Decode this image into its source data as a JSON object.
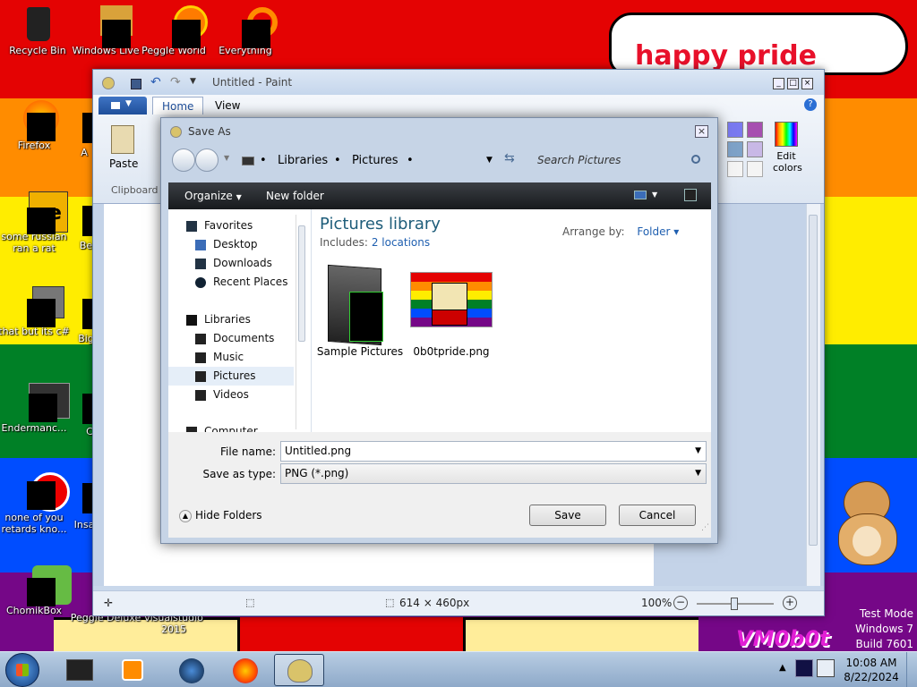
{
  "desktop": {
    "colors": {
      "red": "#e40303",
      "orange": "#ff8c00",
      "yellow": "#ffed00",
      "green": "#008026",
      "blue": "#004dff",
      "purple": "#750787"
    },
    "bubble_text": "happy pride month",
    "icons": [
      {
        "label": "Recycle Bin",
        "name": "recycle-bin-icon"
      },
      {
        "label": "Windows Live",
        "name": "windows-live-icon"
      },
      {
        "label": "Peggle World",
        "name": "peggle-world-icon"
      },
      {
        "label": "Everything",
        "name": "everything-icon"
      },
      {
        "label": "Firefox",
        "name": "firefox-icon"
      },
      {
        "label": "some russian ran a rat",
        "name": "russian-rat-icon"
      },
      {
        "label": "that but its c#",
        "name": "csharp-icon"
      },
      {
        "label": "Endermanc...",
        "name": "endermanch-icon"
      },
      {
        "label": "none of you retards kno...",
        "name": "none-of-you-icon"
      },
      {
        "label": "ChomikBox",
        "name": "chomikbox-icon"
      },
      {
        "label": "Peggle Deluxe",
        "name": "peggle-deluxe-icon"
      },
      {
        "label": "visualstudio 2015",
        "name": "visualstudio-icon"
      }
    ],
    "partial_labels": [
      "A",
      "Be",
      "Big",
      "C",
      "Insa"
    ],
    "watermark": {
      "line1": "Test Mode",
      "line2": "Windows 7",
      "line3": "Build 7601"
    },
    "graffiti": "VM0b0t"
  },
  "paint": {
    "title": "Untitled - Paint",
    "tabs": [
      "Home",
      "View"
    ],
    "paste_label": "Paste",
    "clipboard_label": "Clipboard",
    "edit_colors_label": "Edit colors",
    "status": {
      "dimensions": "614 × 460px",
      "zoom": "100%"
    }
  },
  "dialog": {
    "title": "Save As",
    "breadcrumb": [
      "Libraries",
      "Pictures"
    ],
    "search_placeholder": "Search Pictures",
    "toolbar": {
      "organize": "Organize",
      "new_folder": "New folder"
    },
    "nav": [
      {
        "label": "Favorites",
        "name": "nav-favorites"
      },
      {
        "label": "Desktop",
        "name": "nav-desktop"
      },
      {
        "label": "Downloads",
        "name": "nav-downloads"
      },
      {
        "label": "Recent Places",
        "name": "nav-recent-places"
      },
      {
        "label": "Libraries",
        "name": "nav-libraries"
      },
      {
        "label": "Documents",
        "name": "nav-documents"
      },
      {
        "label": "Music",
        "name": "nav-music"
      },
      {
        "label": "Pictures",
        "name": "nav-pictures",
        "selected": true
      },
      {
        "label": "Videos",
        "name": "nav-videos"
      },
      {
        "label": "Computer",
        "name": "nav-computer"
      }
    ],
    "library_title": "Pictures library",
    "includes_label": "Includes:",
    "includes_link": "2 locations",
    "arrange_label": "Arrange by:",
    "arrange_value": "Folder",
    "files": [
      {
        "label": "Sample Pictures",
        "type": "folder"
      },
      {
        "label": "0b0tpride.png",
        "type": "image"
      }
    ],
    "filename_label": "File name:",
    "filename_value": "Untitled.png",
    "savetype_label": "Save as type:",
    "savetype_value": "PNG (*.png)",
    "hide_folders": "Hide Folders",
    "save": "Save",
    "cancel": "Cancel"
  },
  "taskbar": {
    "time": "10:08 AM",
    "date": "8/22/2024"
  }
}
